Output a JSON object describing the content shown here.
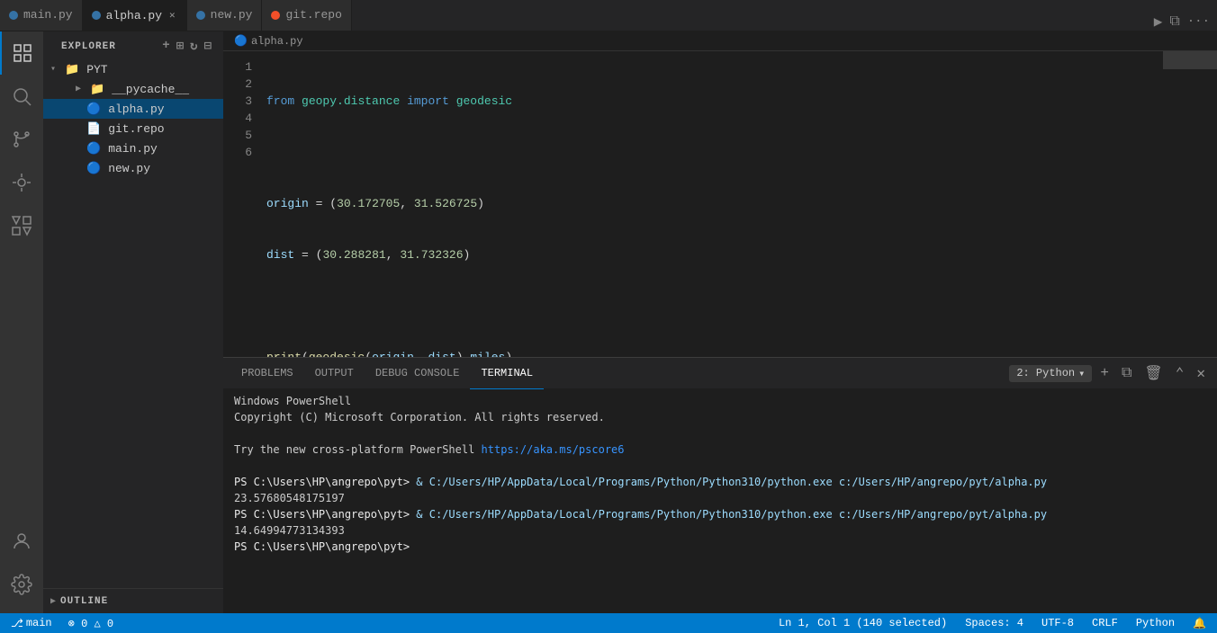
{
  "tabs": [
    {
      "id": "main-py",
      "label": "main.py",
      "type": "py",
      "active": false,
      "closable": false
    },
    {
      "id": "alpha-py",
      "label": "alpha.py",
      "type": "py",
      "active": true,
      "closable": true
    },
    {
      "id": "new-py",
      "label": "new.py",
      "type": "py",
      "active": false,
      "closable": false
    },
    {
      "id": "git-repo",
      "label": "git.repo",
      "type": "git",
      "active": false,
      "closable": false
    }
  ],
  "breadcrumb": {
    "text": "alpha.py"
  },
  "sidebar": {
    "title": "EXPLORER",
    "folder": "PYT",
    "items": [
      {
        "id": "pycache",
        "label": "__pycache__",
        "type": "folder",
        "depth": 1
      },
      {
        "id": "alpha-py",
        "label": "alpha.py",
        "type": "file-py",
        "depth": 1,
        "selected": true
      },
      {
        "id": "git-repo",
        "label": "git.repo",
        "type": "file-git",
        "depth": 1
      },
      {
        "id": "main-py",
        "label": "main.py",
        "type": "file-py",
        "depth": 1
      },
      {
        "id": "new-py",
        "label": "new.py",
        "type": "file-py",
        "depth": 1
      }
    ]
  },
  "code": {
    "lines": [
      {
        "num": 1,
        "text": "from geopy.distance import geodesic"
      },
      {
        "num": 2,
        "text": ""
      },
      {
        "num": 3,
        "text": "origin = (30.172705, 31.526725)"
      },
      {
        "num": 4,
        "text": "dist = (30.288281, 31.732326)"
      },
      {
        "num": 5,
        "text": ""
      },
      {
        "num": 6,
        "text": "print(geodesic(origin, dist).miles)"
      }
    ]
  },
  "terminal": {
    "tabs": [
      {
        "id": "problems",
        "label": "PROBLEMS"
      },
      {
        "id": "output",
        "label": "OUTPUT"
      },
      {
        "id": "debug-console",
        "label": "DEBUG CONSOLE"
      },
      {
        "id": "terminal",
        "label": "TERMINAL",
        "active": true
      }
    ],
    "dropdown": "2: Python",
    "content": [
      {
        "type": "header",
        "text": "Windows PowerShell"
      },
      {
        "type": "text",
        "text": "Copyright (C) Microsoft Corporation. All rights reserved."
      },
      {
        "type": "blank"
      },
      {
        "type": "text",
        "text": "Try the new cross-platform PowerShell https://aka.ms/pscore6"
      },
      {
        "type": "blank"
      },
      {
        "type": "cmd",
        "prompt": "PS C:\\Users\\HP\\angrepo\\pyt>",
        "cmd": " & C:/Users/HP/AppData/Local/Programs/Python/Python310/python.exe c:/Users/HP/angrepo/pyt/alpha.py"
      },
      {
        "type": "output",
        "text": "23.57680548175197"
      },
      {
        "type": "cmd",
        "prompt": "PS C:\\Users\\HP\\angrepo\\pyt>",
        "cmd": " & C:/Users/HP/AppData/Local/Programs/Python/Python310/python.exe c:/Users/HP/angrepo/pyt/alpha.py"
      },
      {
        "type": "output",
        "text": "14.64994773134393"
      },
      {
        "type": "prompt",
        "text": "PS C:\\Users\\HP\\angrepo\\pyt>"
      }
    ]
  },
  "statusbar": {
    "left": [
      {
        "id": "branch",
        "text": "⎇ main"
      },
      {
        "id": "errors",
        "text": "⊗ 0  △ 0"
      }
    ],
    "right": [
      {
        "id": "position",
        "text": "Ln 1, Col 1 (140 selected)"
      },
      {
        "id": "spaces",
        "text": "Spaces: 4"
      },
      {
        "id": "encoding",
        "text": "UTF-8"
      },
      {
        "id": "line-ending",
        "text": "CRLF"
      },
      {
        "id": "language",
        "text": "Python"
      },
      {
        "id": "notifications",
        "text": "🔔"
      }
    ]
  },
  "outline": {
    "label": "OUTLINE"
  }
}
